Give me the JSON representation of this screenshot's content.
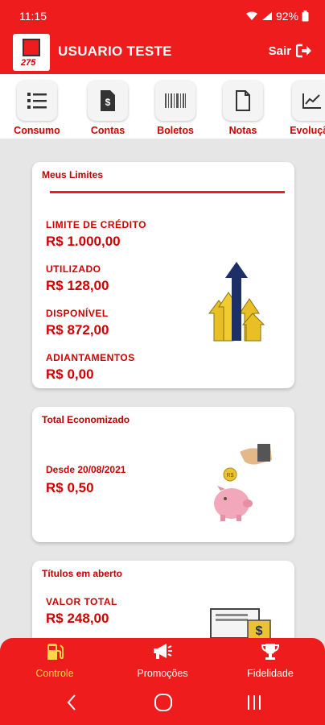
{
  "status": {
    "time": "11:15",
    "battery": "92%"
  },
  "header": {
    "logo_number": "275",
    "username": "USUARIO TESTE",
    "logout_label": "Sair"
  },
  "menu": [
    {
      "label": "Consumo",
      "icon": "list-icon"
    },
    {
      "label": "Contas",
      "icon": "invoice-icon"
    },
    {
      "label": "Boletos",
      "icon": "barcode-icon"
    },
    {
      "label": "Notas",
      "icon": "document-icon"
    },
    {
      "label": "Evolução",
      "icon": "chart-line-icon"
    }
  ],
  "limits_card": {
    "title": "Meus Limites",
    "credit_limit_label": "LIMITE DE CRÉDITO",
    "credit_limit_value": "R$ 1.000,00",
    "used_label": "UTILIZADO",
    "used_value": "R$ 128,00",
    "available_label": "DISPONÍVEL",
    "available_value": "R$ 872,00",
    "advances_label": "ADIANTAMENTOS",
    "advances_value": "R$ 0,00"
  },
  "savings_card": {
    "title": "Total Economizado",
    "since_label": "Desde 20/08/2021",
    "value": "R$ 0,50",
    "coin_text": "R$"
  },
  "open_titles_card": {
    "title": "Títulos em aberto",
    "total_label": "VALOR TOTAL",
    "total_value": "R$ 248,00"
  },
  "bottom_nav": [
    {
      "label": "Controle",
      "icon": "fuel-pump-icon",
      "active": true
    },
    {
      "label": "Promoções",
      "icon": "megaphone-icon",
      "active": false
    },
    {
      "label": "Fidelidade",
      "icon": "trophy-icon",
      "active": false
    }
  ],
  "colors": {
    "brand_red": "#ee1c1c",
    "text_red": "#d00000",
    "active_nav": "#ffd84a",
    "background": "#e6e6e6"
  }
}
